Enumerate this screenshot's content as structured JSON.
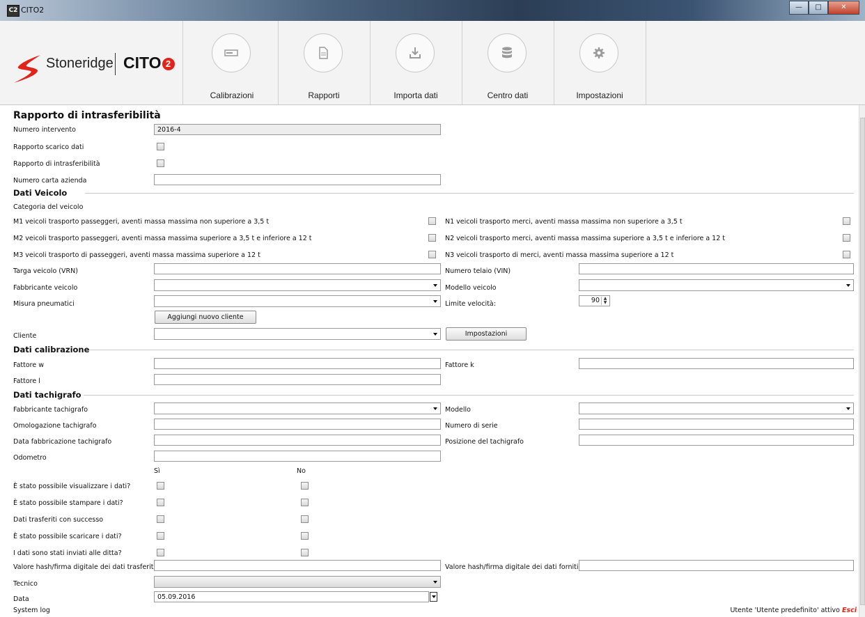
{
  "window": {
    "title": "CITO2",
    "app_icon": "C2"
  },
  "brand": {
    "name": "Stoneridge",
    "product": "CITO",
    "product_num": "2",
    "accent": "#e2231a"
  },
  "nav": [
    {
      "label": "Calibrazioni",
      "icon": "card-icon"
    },
    {
      "label": "Rapporti",
      "icon": "document-icon"
    },
    {
      "label": "Importa dati",
      "icon": "download-icon"
    },
    {
      "label": "Centro dati",
      "icon": "database-icon"
    },
    {
      "label": "Impostazioni",
      "icon": "gear-icon"
    }
  ],
  "form": {
    "title": "Rapporto di intrasferibilità",
    "numero_intervento_label": "Numero intervento",
    "numero_intervento_value": "2016-4",
    "rapporto_scarico_label": "Rapporto scarico dati",
    "rapporto_intrasferibilita_label": "Rapporto di intrasferibilità",
    "numero_carta_label": "Numero carta azienda",
    "vehicle": {
      "section": "Dati Veicolo",
      "categoria_label": "Categoria del veicolo",
      "m1": "M1 veicoli trasporto passeggeri, aventi massa massima non superiore a 3,5 t",
      "m2": "M2 veicoli trasporto passeggeri, aventi massa massima superiore a 3,5 t e inferiore a 12 t",
      "m3": "M3 veicoli trasporto di passeggeri, aventi massa massima superiore a 12 t",
      "n1": "N1 veicoli trasporto merci, aventi massa massima non superiore a 3,5 t",
      "n2": "N2 veicoli trasporto merci, aventi massa massima superiore a 3,5 t e inferiore a 12 t",
      "n3": "N3 veicoli trasporto di merci, aventi massa massima superiore a 12 t",
      "targa_label": "Targa veicolo (VRN)",
      "telaio_label": "Numero telaio (VIN)",
      "fabbricante_label": "Fabbricante veicolo",
      "modello_label": "Modello veicolo",
      "pneumatici_label": "Misura pneumatici",
      "limite_label": "Limite velocità:",
      "limite_value": "90",
      "add_client_button": "Aggiungi nuovo cliente",
      "cliente_label": "Cliente",
      "impostazioni_button": "Impostazioni"
    },
    "calibration": {
      "section": "Dati calibrazione",
      "w_label": "Fattore w",
      "k_label": "Fattore k",
      "l_label": "Fattore l"
    },
    "tachograph": {
      "section": "Dati tachigrafo",
      "fabbricante_label": "Fabbricante tachigrafo",
      "modello_label": "Modello",
      "omologazione_label": "Omologazione tachigrafo",
      "serie_label": "Numero di serie",
      "data_fabbr_label": "Data fabbricazione tachigrafo",
      "posizione_label": "Posizione del tachigrafo",
      "odometro_label": "Odometro",
      "si_label": "Sì",
      "no_label": "No",
      "questions": [
        "È stato possibile visualizzare i dati?",
        "È stato possibile stampare i dati?",
        "Dati trasferiti con successo",
        "È stato possibile scaricare i dati?",
        "I dati sono stati inviati alle ditta?"
      ],
      "hash_transferred_label": "Valore hash/firma digitale dei dati trasferiti",
      "hash_provided_label": "Valore hash/firma digitale dei dati forniti",
      "tecnico_label": "Tecnico",
      "data_label": "Data",
      "data_value": "05.09.2016"
    }
  },
  "status": {
    "log": "System log",
    "user": "Utente 'Utente predefinito' attivo",
    "esc": "Esci"
  }
}
